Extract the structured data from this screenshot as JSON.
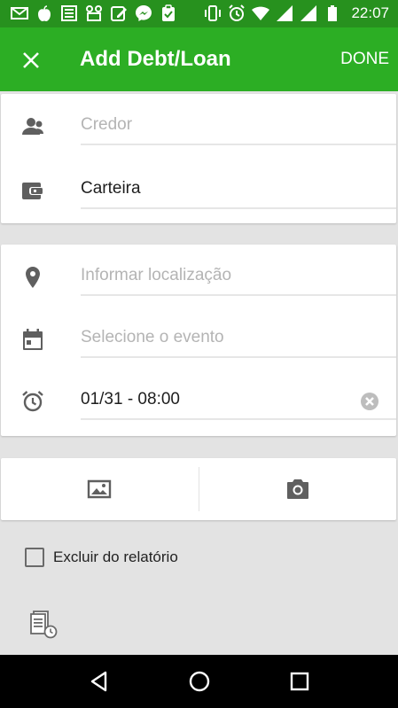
{
  "status_bar": {
    "time": "22:07",
    "left_icons": [
      "gmail-icon",
      "apple-icon",
      "newspaper-icon",
      "apk-icon",
      "edit-icon",
      "messenger-icon",
      "clipboard-icon"
    ],
    "right_icons": [
      "vibrate-icon",
      "alarm-icon",
      "wifi-icon",
      "signal-icon",
      "signal-icon",
      "battery-icon"
    ]
  },
  "app_bar": {
    "title": "Add Debt/Loan",
    "done_label": "DONE"
  },
  "form": {
    "creditor": {
      "value": "",
      "placeholder": "Credor"
    },
    "wallet": {
      "value": "Carteira",
      "placeholder": ""
    },
    "location": {
      "value": "",
      "placeholder": "Informar localização"
    },
    "event": {
      "value": "",
      "placeholder": "Selecione o evento"
    },
    "reminder": {
      "value": "01/31 - 08:00",
      "placeholder": ""
    }
  },
  "exclude_report": {
    "label": "Excluir do relatório",
    "checked": false
  },
  "colors": {
    "status_bar": "#27911e",
    "app_bar": "#2cae24",
    "background": "#e3e3e3",
    "icon": "#5f5f5f"
  }
}
